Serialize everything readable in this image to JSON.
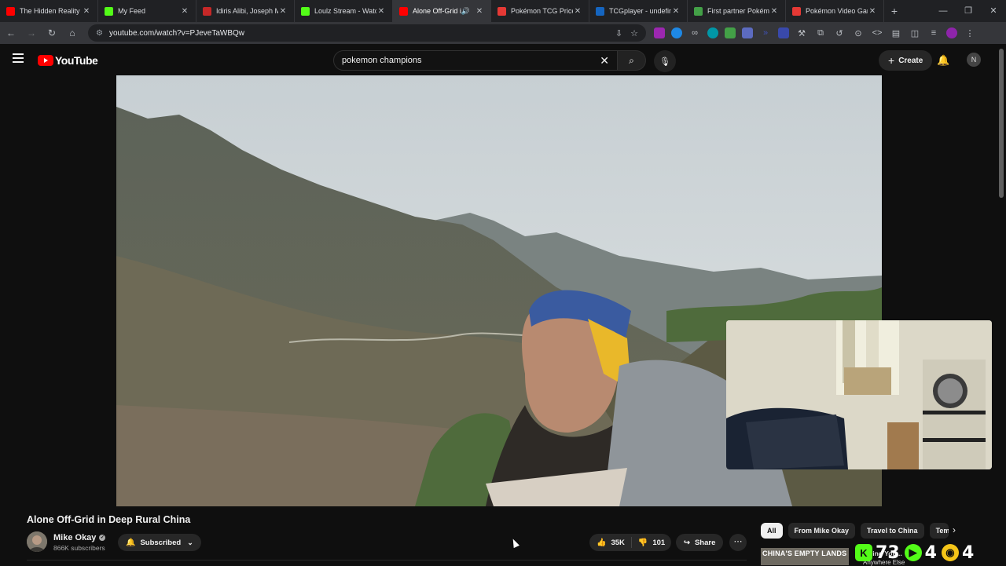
{
  "browser": {
    "tabs": [
      {
        "title": "The Hidden Reality of",
        "favicon_color": "#ff0000",
        "active": false
      },
      {
        "title": "My Feed",
        "favicon_color": "#53fc18",
        "active": false
      },
      {
        "title": "Idiris Alibi, Joseph Mc",
        "favicon_color": "#c62828",
        "active": false
      },
      {
        "title": "Loulz Stream - Watch",
        "favicon_color": "#53fc18",
        "active": false
      },
      {
        "title": "Alone Off-Grid in",
        "favicon_color": "#ff0000",
        "active": true
      },
      {
        "title": "Pokémon TCG Price W",
        "favicon_color": "#e53935",
        "active": false
      },
      {
        "title": "TCGplayer - undefine",
        "favicon_color": "#1565c0",
        "active": false
      },
      {
        "title": "First partner Pokémo",
        "favicon_color": "#43a047",
        "active": false
      },
      {
        "title": "Pokémon Video Gam",
        "favicon_color": "#e53935",
        "active": false
      }
    ],
    "url": "youtube.com/watch?v=PJeveTaWBQw"
  },
  "youtube": {
    "logo_text": "YouTube",
    "search_value": "pokemon champions",
    "create_label": "Create",
    "avatar_letter": "N"
  },
  "video": {
    "title": "Alone Off-Grid in Deep Rural China",
    "channel": "Mike Okay",
    "subscribers": "866K subscribers",
    "subscribe_label": "Subscribed",
    "likes": "35K",
    "dislikes": "101",
    "share_label": "Share"
  },
  "chips": [
    "All",
    "From Mike Okay",
    "Travel to China",
    "Tem"
  ],
  "recommendation": {
    "thumb_text": "CHINA'S EMPTY LANDS",
    "title": "Living You...",
    "subtitle": "Anywhere Else"
  },
  "overlay_counts": [
    {
      "icon": "K",
      "value": "7",
      "color": "#53fc18"
    },
    {
      "icon": "3",
      "value": "3",
      "color": "#111111"
    },
    {
      "icon": "▶",
      "value": "4",
      "color": "#53fc18"
    },
    {
      "icon": "◉",
      "value": "4",
      "color": "#f5c518"
    }
  ]
}
